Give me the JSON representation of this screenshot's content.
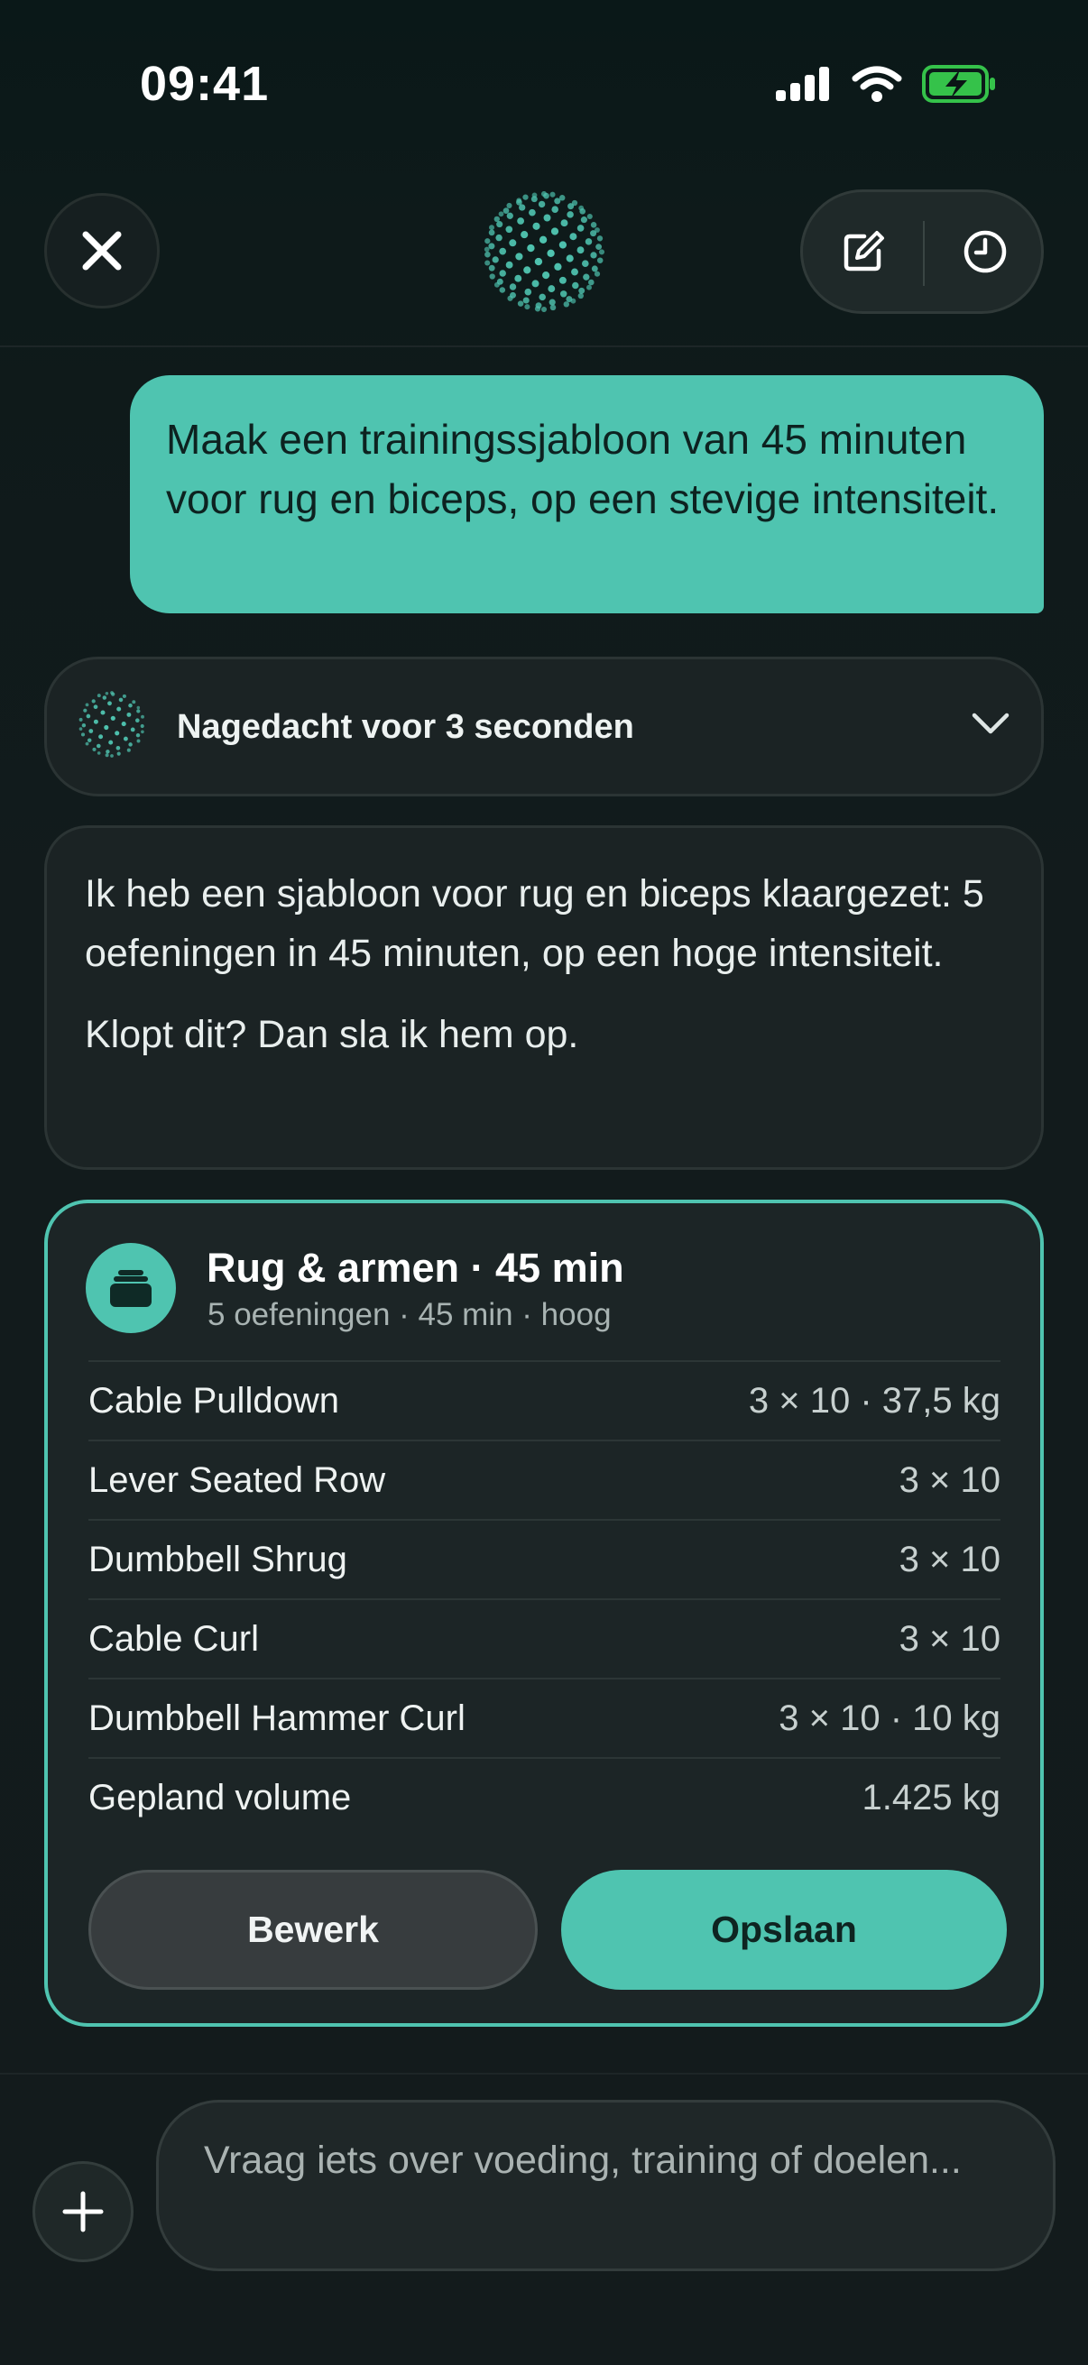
{
  "status_bar": {
    "time": "09:41"
  },
  "header": {
    "close_icon": "close-icon",
    "logo": "dotted-orb-logo",
    "new_chat_icon": "compose-icon",
    "history_icon": "clock-icon"
  },
  "chat": {
    "user_message": "Maak een trainingssjabloon van 45 minuten voor rug en biceps, op een stevige intensiteit.",
    "thought_label": "Nagedacht voor 3 seconden",
    "assistant_paragraph_1": "Ik heb een sjabloon voor rug en biceps klaargezet: 5 oefeningen in 45 minuten, op een hoge intensiteit.",
    "assistant_paragraph_2": "Klopt dit? Dan sla ik hem op."
  },
  "template_card": {
    "title": "Rug & armen · 45 min",
    "subtitle": "5 oefeningen · 45 min · hoog",
    "rows": [
      {
        "name": "Cable Pulldown",
        "value": "3 × 10 · 37,5 kg"
      },
      {
        "name": "Lever Seated Row",
        "value": "3 × 10"
      },
      {
        "name": "Dumbbell Shrug",
        "value": "3 × 10"
      },
      {
        "name": "Cable Curl",
        "value": "3 × 10"
      },
      {
        "name": "Dumbbell Hammer Curl",
        "value": "3 × 10 · 10 kg"
      },
      {
        "name": "Gepland volume",
        "value": "1.425 kg"
      }
    ],
    "edit_label": "Bewerk",
    "save_label": "Opslaan"
  },
  "composer": {
    "placeholder": "Vraag iets over voeding, training of doelen..."
  },
  "colors": {
    "accent": "#4fc4b0",
    "background": "#111a1a",
    "surface": "#1b2324"
  }
}
